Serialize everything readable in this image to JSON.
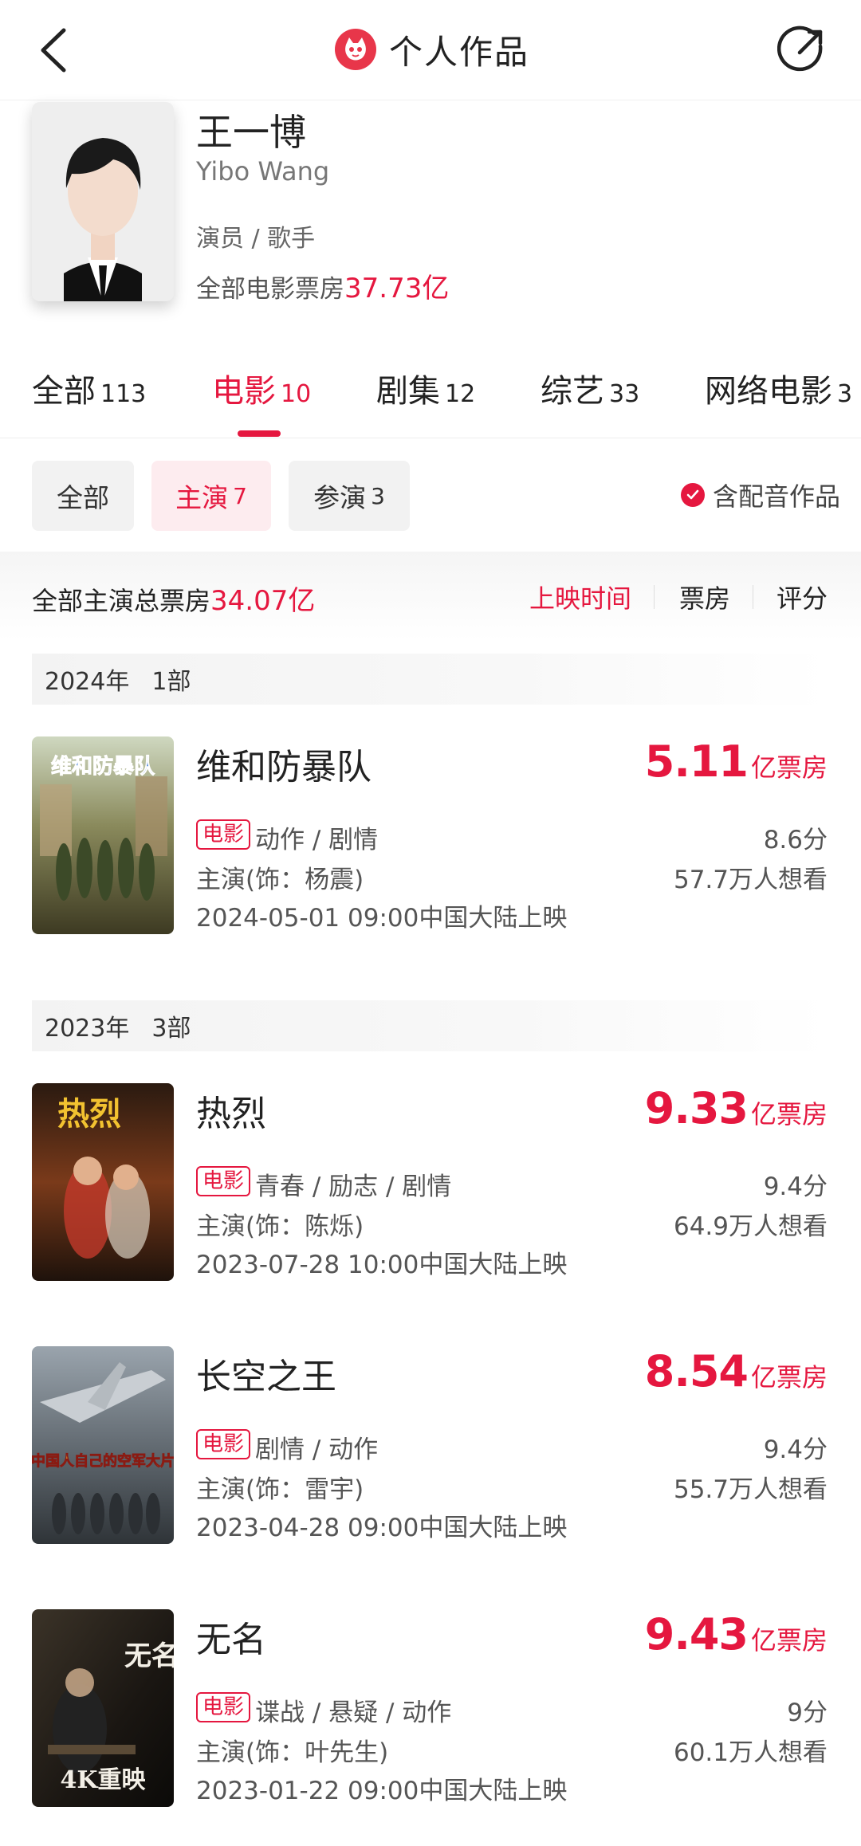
{
  "header": {
    "title": "个人作品"
  },
  "profile": {
    "name_cn": "王一博",
    "name_en": "Yibo Wang",
    "roles": "演员 / 歌手",
    "boxoffice_label": "全部电影票房",
    "boxoffice_value": "37.73亿"
  },
  "tabs": [
    {
      "label": "全部",
      "count": "113"
    },
    {
      "label": "电影",
      "count": "10"
    },
    {
      "label": "剧集",
      "count": "12"
    },
    {
      "label": "综艺",
      "count": "33"
    },
    {
      "label": "网络电影",
      "count": "3"
    }
  ],
  "filters": [
    {
      "label": "全部",
      "count": ""
    },
    {
      "label": "主演",
      "count": "7"
    },
    {
      "label": "参演",
      "count": "3"
    }
  ],
  "dub_toggle": {
    "label": "含配音作品",
    "checked": true
  },
  "summary": {
    "label": "全部主演总票房",
    "value": "34.07亿",
    "sorts": [
      "上映时间",
      "票房",
      "评分"
    ]
  },
  "years": [
    {
      "year": "2024年",
      "count": "1部"
    },
    {
      "year": "2023年",
      "count": "3部"
    }
  ],
  "movies": [
    {
      "title": "维和防暴队",
      "boxoffice": "5.11",
      "box_unit": "亿票房",
      "tag": "电影",
      "genre": "动作 / 剧情",
      "score": "8.6分",
      "role": "主演(饰：杨震)",
      "want": "57.7万人想看",
      "date": "2024-05-01 09:00中国大陆上映",
      "poster_text": "维和防暴队"
    },
    {
      "title": "热烈",
      "boxoffice": "9.33",
      "box_unit": "亿票房",
      "tag": "电影",
      "genre": "青春 / 励志 / 剧情",
      "score": "9.4分",
      "role": "主演(饰：陈烁)",
      "want": "64.9万人想看",
      "date": "2023-07-28 10:00中国大陆上映",
      "poster_text": "热烈"
    },
    {
      "title": "长空之王",
      "boxoffice": "8.54",
      "box_unit": "亿票房",
      "tag": "电影",
      "genre": "剧情 / 动作",
      "score": "9.4分",
      "role": "主演(饰：雷宇)",
      "want": "55.7万人想看",
      "date": "2023-04-28 09:00中国大陆上映",
      "poster_text": "中国人自己的空军大片"
    },
    {
      "title": "无名",
      "boxoffice": "9.43",
      "box_unit": "亿票房",
      "tag": "电影",
      "genre": "谍战 / 悬疑 / 动作",
      "score": "9分",
      "role": "主演(饰：叶先生)",
      "want": "60.1万人想看",
      "date": "2023-01-22 09:00中国大陆上映",
      "poster_text": "4K重映"
    }
  ],
  "colors": {
    "accent": "#e5173f",
    "text": "#222222",
    "muted": "#555555"
  }
}
